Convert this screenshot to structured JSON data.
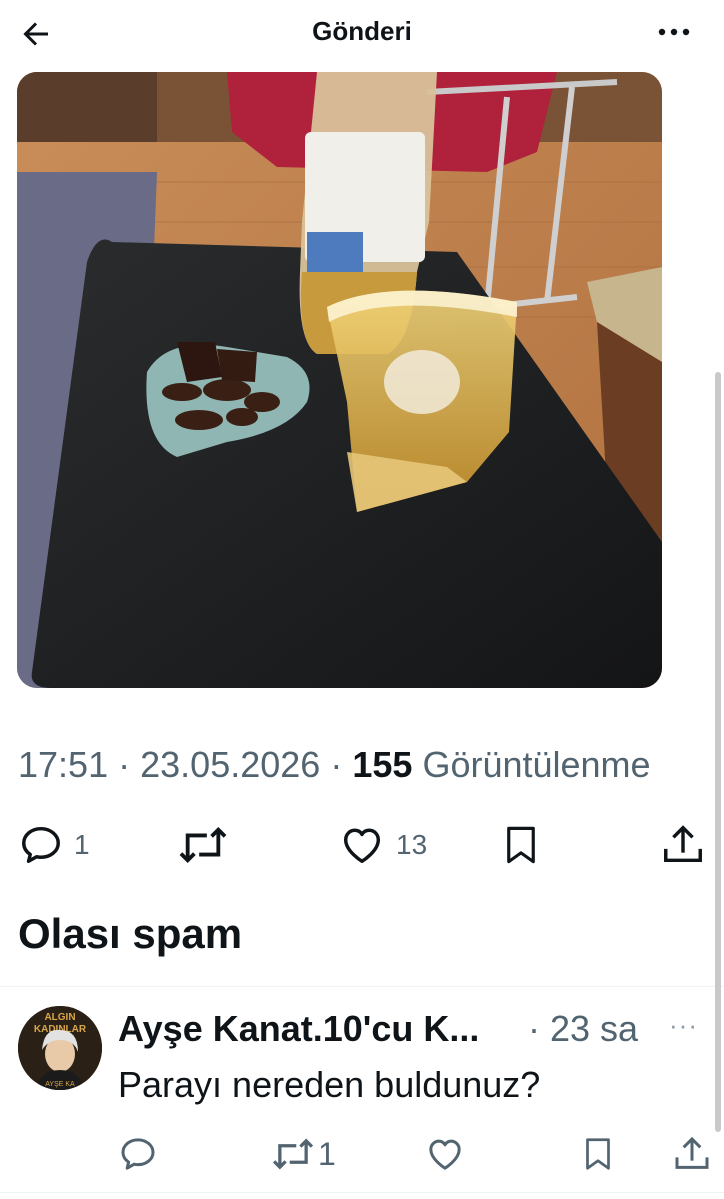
{
  "header": {
    "title": "Gönderi",
    "back_icon": "arrow-left-icon",
    "more_icon": "more-horizontal-icon"
  },
  "post": {
    "time": "17:51",
    "date": "23.05.2026",
    "views_count": "155",
    "views_label": "Görüntülenme",
    "separator": "·",
    "actions": {
      "replies": "1",
      "retweets": "",
      "likes": "13"
    },
    "image_icon": "post-photo"
  },
  "spam_section": {
    "heading": "Olası spam"
  },
  "reply": {
    "author": "Ayşe Kanat.10'cu K...",
    "separator": "·",
    "time": "23 sa",
    "text": "Parayı nereden buldunuz?",
    "more": "···",
    "retweets": "1",
    "avatar_text_top": "ALGIN",
    "avatar_text_mid": "KADINLAR",
    "avatar_text_bottom": "AYŞE KA"
  },
  "colors": {
    "text": "#0f1419",
    "secondary": "#536471",
    "divider": "#eff3f4"
  }
}
